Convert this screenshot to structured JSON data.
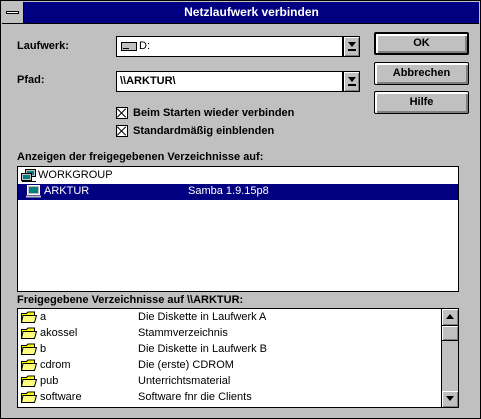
{
  "window": {
    "title": "Netzlaufwerk verbinden"
  },
  "drive": {
    "label": "Laufwerk:",
    "value": "D:"
  },
  "path": {
    "label": "Pfad:",
    "value": "\\\\ARKTUR\\"
  },
  "options": {
    "reconnect": {
      "label": "Beim Starten wieder verbinden",
      "checked": true
    },
    "show_default": {
      "label": "Standardmäßig einblenden",
      "checked": true
    }
  },
  "buttons": {
    "ok": "OK",
    "cancel": "Abbrechen",
    "help": "Hilfe"
  },
  "shared_dirs_label": "Anzeigen der freigegebenen Verzeichnisse auf:",
  "network_tree": [
    {
      "name": "WORKGROUP",
      "comment": "",
      "icon": "workgroup-icon",
      "selected": false
    },
    {
      "name": "ARKTUR",
      "comment": "Samba 1.9.15p8",
      "icon": "computer-icon",
      "selected": true
    }
  ],
  "shares_label": "Freigegebene Verzeichnisse auf \\\\ARKTUR:",
  "shares": [
    {
      "name": "a",
      "comment": "Die Diskette in Laufwerk A"
    },
    {
      "name": "akossel",
      "comment": "Stammverzeichnis"
    },
    {
      "name": "b",
      "comment": "Die Diskette in Laufwerk B"
    },
    {
      "name": "cdrom",
      "comment": "Die (erste) CDROM"
    },
    {
      "name": "pub",
      "comment": "Unterrichtsmaterial"
    },
    {
      "name": "software",
      "comment": "Software fnr die Clients"
    }
  ],
  "colors": {
    "title_bar": "#000080",
    "face": "#c0c0c0",
    "selection": "#000080"
  }
}
